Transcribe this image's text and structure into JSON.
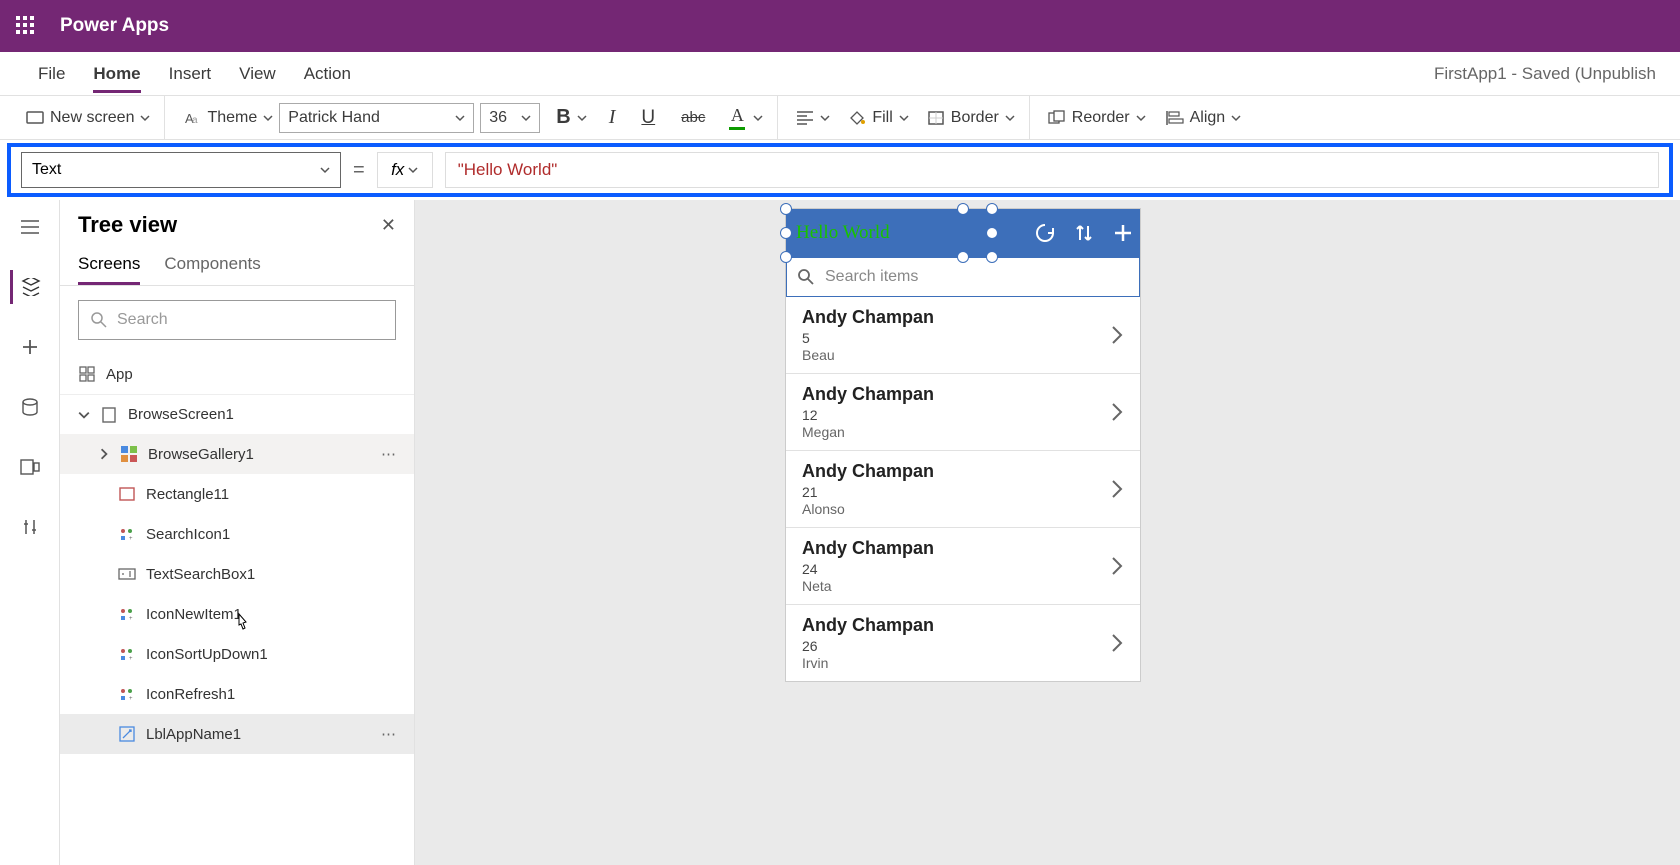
{
  "titlebar": {
    "app_name": "Power Apps"
  },
  "menubar": {
    "items": [
      "File",
      "Home",
      "Insert",
      "View",
      "Action"
    ],
    "active_index": 1,
    "doc_status": "FirstApp1 - Saved (Unpublish"
  },
  "ribbon": {
    "new_screen": "New screen",
    "theme": "Theme",
    "font_name": "Patrick Hand",
    "font_size": "36",
    "fill": "Fill",
    "border": "Border",
    "reorder": "Reorder",
    "align": "Align"
  },
  "formula": {
    "property": "Text",
    "fx": "fx",
    "value": "\"Hello World\""
  },
  "tree": {
    "title": "Tree view",
    "tabs": [
      "Screens",
      "Components"
    ],
    "active_tab": 0,
    "search_placeholder": "Search",
    "items": [
      {
        "label": "App",
        "indent": 1,
        "icon": "app",
        "expanded": null
      },
      {
        "label": "BrowseScreen1",
        "indent": 1,
        "icon": "screen",
        "expanded": true
      },
      {
        "label": "BrowseGallery1",
        "indent": 2,
        "icon": "gallery",
        "expanded": false,
        "more": true,
        "hover": true
      },
      {
        "label": "Rectangle11",
        "indent": 3,
        "icon": "rect"
      },
      {
        "label": "SearchIcon1",
        "indent": 3,
        "icon": "iconctrl"
      },
      {
        "label": "TextSearchBox1",
        "indent": 3,
        "icon": "textbox"
      },
      {
        "label": "IconNewItem1",
        "indent": 3,
        "icon": "iconctrl"
      },
      {
        "label": "IconSortUpDown1",
        "indent": 3,
        "icon": "iconctrl"
      },
      {
        "label": "IconRefresh1",
        "indent": 3,
        "icon": "iconctrl"
      },
      {
        "label": "LblAppName1",
        "indent": 3,
        "icon": "label",
        "selected": true,
        "more": true
      }
    ]
  },
  "phone": {
    "title": "Hello World",
    "search_placeholder": "Search items",
    "gallery": [
      {
        "name": "Andy Champan",
        "num": "5",
        "sub": "Beau"
      },
      {
        "name": "Andy Champan",
        "num": "12",
        "sub": "Megan"
      },
      {
        "name": "Andy Champan",
        "num": "21",
        "sub": "Alonso"
      },
      {
        "name": "Andy Champan",
        "num": "24",
        "sub": "Neta"
      },
      {
        "name": "Andy Champan",
        "num": "26",
        "sub": "Irvin"
      }
    ]
  }
}
